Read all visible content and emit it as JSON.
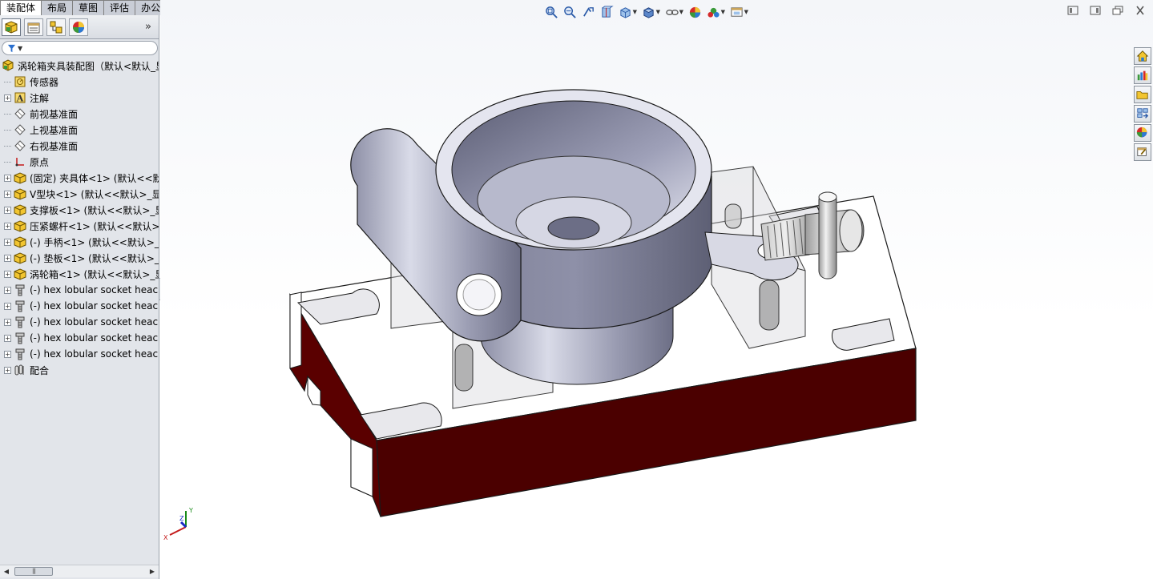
{
  "command_tabs": [
    "装配体",
    "布局",
    "草图",
    "评估",
    "办公室产品"
  ],
  "panel_tabs": [
    {
      "name": "featuremanager-icon"
    },
    {
      "name": "propertymanager-icon"
    },
    {
      "name": "configurationmanager-icon"
    },
    {
      "name": "display-manager-icon"
    }
  ],
  "panel_expand_label": "»",
  "tree": {
    "root_label": "涡轮箱夹具装配图（默认<默认_显",
    "items": [
      {
        "label": "传感器",
        "icon": "sensor-icon",
        "expand": false
      },
      {
        "label": "注解",
        "icon": "annotation-icon",
        "expand": true
      },
      {
        "label": "前视基准面",
        "icon": "plane-icon",
        "expand": false
      },
      {
        "label": "上视基准面",
        "icon": "plane-icon",
        "expand": false
      },
      {
        "label": "右视基准面",
        "icon": "plane-icon",
        "expand": false
      },
      {
        "label": "原点",
        "icon": "origin-icon",
        "expand": false
      },
      {
        "label": "(固定) 夹具体<1> (默认<<默",
        "icon": "part-icon",
        "expand": true
      },
      {
        "label": "V型块<1> (默认<<默认>_显",
        "icon": "part-icon",
        "expand": true
      },
      {
        "label": "支撑板<1> (默认<<默认>_显",
        "icon": "part-icon",
        "expand": true
      },
      {
        "label": "压紧螺杆<1> (默认<<默认>",
        "icon": "part-icon",
        "expand": true
      },
      {
        "label": "(-) 手柄<1> (默认<<默认>_",
        "icon": "part-icon",
        "expand": true
      },
      {
        "label": "(-) 垫板<1> (默认<<默认>_",
        "icon": "part-icon",
        "expand": true
      },
      {
        "label": "涡轮箱<1> (默认<<默认>_显",
        "icon": "part-icon",
        "expand": true
      },
      {
        "label": "(-) hex lobular socket heac",
        "icon": "screw-icon",
        "expand": true
      },
      {
        "label": "(-) hex lobular socket heac",
        "icon": "screw-icon",
        "expand": true
      },
      {
        "label": "(-) hex lobular socket heac",
        "icon": "screw-icon",
        "expand": true
      },
      {
        "label": "(-) hex lobular socket heac",
        "icon": "screw-icon",
        "expand": true
      },
      {
        "label": "(-) hex lobular socket heac",
        "icon": "screw-icon",
        "expand": true
      },
      {
        "label": "配合",
        "icon": "mates-icon",
        "expand": true
      }
    ]
  },
  "hud_toolbar": [
    {
      "name": "zoom-to-fit-icon",
      "dropdown": false
    },
    {
      "name": "zoom-to-area-icon",
      "dropdown": false
    },
    {
      "name": "previous-view-icon",
      "dropdown": false
    },
    {
      "name": "section-view-icon",
      "dropdown": false
    },
    {
      "name": "view-orientation-icon",
      "dropdown": true
    },
    {
      "name": "display-style-icon",
      "dropdown": true
    },
    {
      "name": "hide-show-items-icon",
      "dropdown": true
    },
    {
      "name": "edit-appearance-icon",
      "dropdown": false
    },
    {
      "name": "apply-scene-icon",
      "dropdown": true
    },
    {
      "name": "view-settings-icon",
      "dropdown": true
    }
  ],
  "window_controls": [
    "tile-horizontal-icon",
    "tile-vertical-icon",
    "restore-icon",
    "close-icon"
  ],
  "task_pane": [
    "solidworks-resources-icon",
    "design-library-icon",
    "file-explorer-icon",
    "view-palette-icon",
    "appearances-icon",
    "custom-properties-icon"
  ],
  "triad": {
    "x": "X",
    "y": "Y",
    "z": "Z"
  },
  "colors": {
    "part_gray": "#a9abbf",
    "base_plate": "#ffffff",
    "side_face_red": "#4b0000",
    "edge": "#1a1a1a",
    "transparent_block": "#d9dade"
  }
}
